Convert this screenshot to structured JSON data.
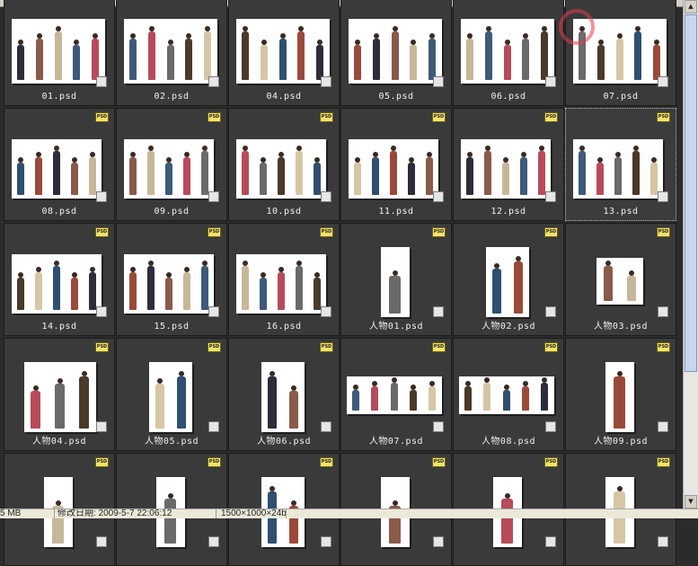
{
  "files": [
    {
      "name": "01.psd",
      "badge": false
    },
    {
      "name": "02.psd",
      "badge": false
    },
    {
      "name": "04.psd",
      "badge": false
    },
    {
      "name": "05.psd",
      "badge": false
    },
    {
      "name": "06.psd",
      "badge": false
    },
    {
      "name": "07.psd",
      "badge": false
    },
    {
      "name": "08.psd",
      "badge": true
    },
    {
      "name": "09.psd",
      "badge": true
    },
    {
      "name": "10.psd",
      "badge": true
    },
    {
      "name": "11.psd",
      "badge": true
    },
    {
      "name": "12.psd",
      "badge": true
    },
    {
      "name": "13.psd",
      "badge": true,
      "selected": true
    },
    {
      "name": "14.psd",
      "badge": true
    },
    {
      "name": "15.psd",
      "badge": true
    },
    {
      "name": "16.psd",
      "badge": true
    },
    {
      "name": "人物01.psd",
      "badge": true
    },
    {
      "name": "人物02.psd",
      "badge": true
    },
    {
      "name": "人物03.psd",
      "badge": true
    },
    {
      "name": "人物04.psd",
      "badge": true
    },
    {
      "name": "人物05.psd",
      "badge": true
    },
    {
      "name": "人物06.psd",
      "badge": true
    },
    {
      "name": "人物07.psd",
      "badge": true
    },
    {
      "name": "人物08.psd",
      "badge": true
    },
    {
      "name": "人物09.psd",
      "badge": true
    },
    {
      "name": "",
      "badge": true
    },
    {
      "name": "",
      "badge": true
    },
    {
      "name": "",
      "badge": true
    },
    {
      "name": "",
      "badge": true
    },
    {
      "name": "",
      "badge": true
    },
    {
      "name": "",
      "badge": true
    }
  ],
  "badge_text": "PSD",
  "status": {
    "size": "5 MB",
    "modified": "修改日期: 2009-5-7 22:06:12",
    "dimensions": "1500×1000×24b"
  },
  "colors": {
    "background": "#2b2b2b",
    "cell": "#3a3a3a",
    "label": "#f0f0f0",
    "badge": "#f3e36a"
  }
}
